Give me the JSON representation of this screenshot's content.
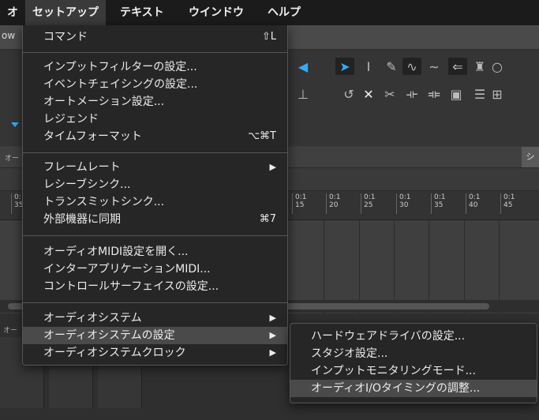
{
  "menubar": {
    "items": [
      {
        "label": "オ"
      },
      {
        "label": "セットアップ"
      },
      {
        "label": "テキスト"
      },
      {
        "label": "ウインドウ"
      },
      {
        "label": "ヘルプ"
      }
    ]
  },
  "app": {
    "toolbar_label": "ow",
    "rowbar_small": "オー",
    "rowbar_tab": "シ",
    "lower_small": "オー",
    "ruler_ticks": [
      "0:\n35",
      "0:1\n15",
      "0:1\n20",
      "0:1\n25",
      "0:1\n30",
      "0:1\n35",
      "0:1\n40",
      "0:1\n45"
    ]
  },
  "setup_menu": {
    "items": [
      {
        "label": "コマンド",
        "shortcut": "⇧L"
      },
      {
        "label": "インプットフィルターの設定..."
      },
      {
        "label": "イベントチェイシングの設定..."
      },
      {
        "label": "オートメーション設定..."
      },
      {
        "label": "レジェンド"
      },
      {
        "label": "タイムフォーマット",
        "shortcut": "⌥⌘T"
      },
      {
        "label": "フレームレート",
        "submenu": "▶"
      },
      {
        "label": "レシーブシンク..."
      },
      {
        "label": "トランスミットシンク..."
      },
      {
        "label": "外部機器に同期",
        "shortcut": "⌘7"
      },
      {
        "label": "オーディオMIDI設定を開く..."
      },
      {
        "label": "インターアプリケーションMIDI..."
      },
      {
        "label": "コントロールサーフェイスの設定..."
      },
      {
        "label": "オーディオシステム",
        "submenu": "▶"
      },
      {
        "label": "オーディオシステムの設定",
        "submenu": "▶"
      },
      {
        "label": "オーディオシステムクロック",
        "submenu": "▶"
      }
    ]
  },
  "audio_settings_submenu": {
    "items": [
      {
        "label": "ハードウェアドライバの設定..."
      },
      {
        "label": "スタジオ設定..."
      },
      {
        "label": "インプットモニタリングモード..."
      },
      {
        "label": "オーディオI/Oタイミングの調整..."
      }
    ]
  }
}
